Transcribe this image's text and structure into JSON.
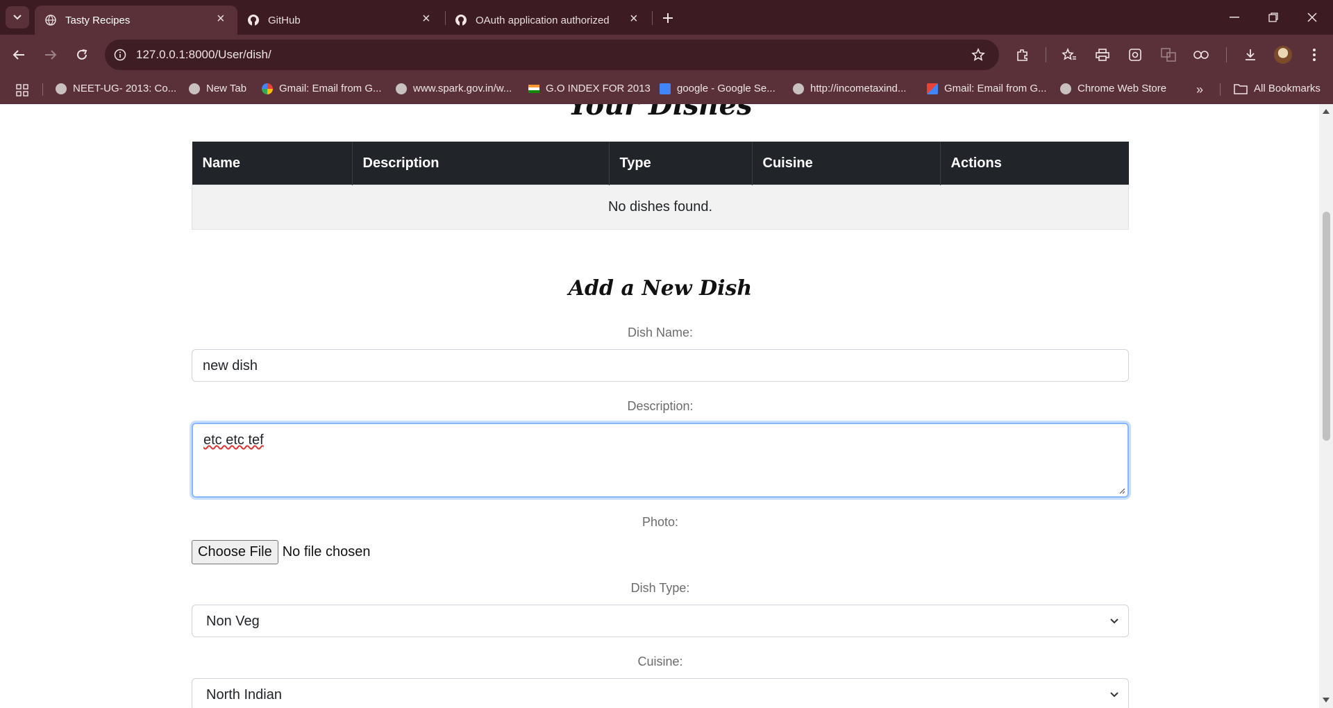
{
  "browser": {
    "tabs": [
      {
        "title": "Tasty Recipes",
        "icon": "globe-icon"
      },
      {
        "title": "GitHub",
        "icon": "github-icon"
      },
      {
        "title": "OAuth application authorized",
        "icon": "github-icon"
      }
    ],
    "url": "127.0.0.1:8000/User/dish/",
    "bookmarks": [
      "NEET-UG- 2013: Co...",
      "New Tab",
      "Gmail: Email from G...",
      "www.spark.gov.in/w...",
      "G.O INDEX FOR 2013",
      "google - Google Se...",
      "http://incometaxind...",
      "Gmail: Email from G...",
      "Chrome Web Store"
    ],
    "all_bookmarks": "All Bookmarks"
  },
  "page": {
    "section_title": "Your Dishes",
    "table": {
      "headers": [
        "Name",
        "Description",
        "Type",
        "Cuisine",
        "Actions"
      ],
      "empty_text": "No dishes found."
    },
    "form": {
      "title": "Add a New Dish",
      "dish_name_label": "Dish Name:",
      "dish_name_value": "new dish",
      "description_label": "Description:",
      "description_value": "etc etc tef",
      "photo_label": "Photo:",
      "choose_file": "Choose File",
      "no_file": "No file chosen",
      "dish_type_label": "Dish Type:",
      "dish_type_value": "Non Veg",
      "cuisine_label": "Cuisine:",
      "cuisine_value": "North Indian"
    }
  },
  "colors": {
    "tabstrip": "#3c1c22",
    "toolbar": "#5a3138",
    "table_header": "#212529",
    "focus_border": "#86b7fe"
  }
}
